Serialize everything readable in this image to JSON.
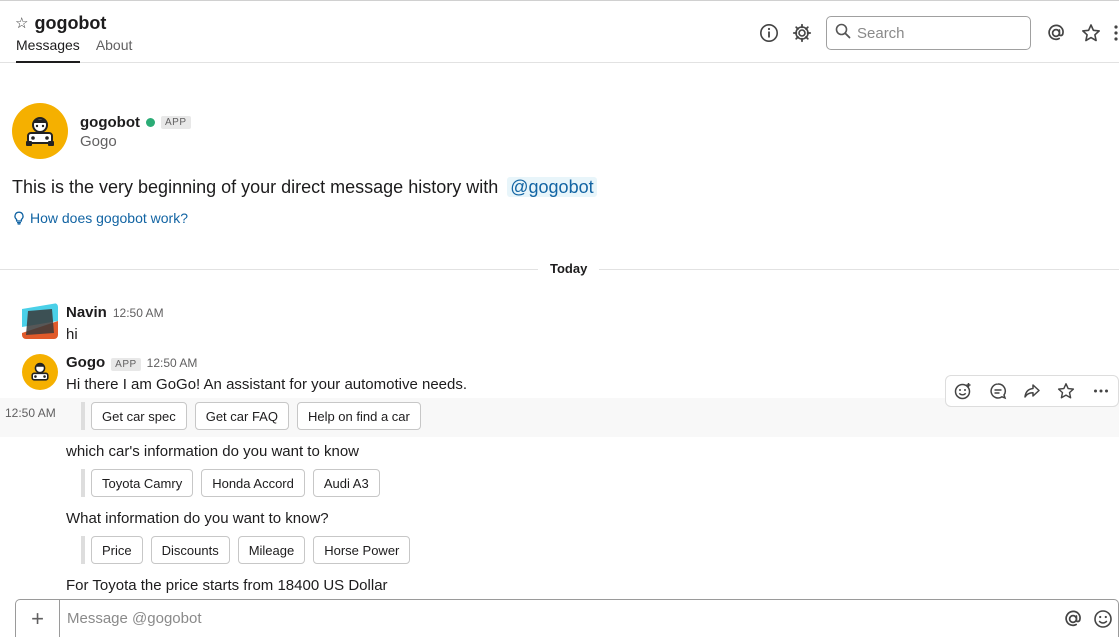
{
  "header": {
    "channel_name": "gogobot",
    "tabs": [
      {
        "label": "Messages",
        "active": true
      },
      {
        "label": "About",
        "active": false
      }
    ],
    "search_placeholder": "Search"
  },
  "intro": {
    "bot_name": "gogobot",
    "app_badge": "APP",
    "subtitle": "Gogo",
    "beginning_text": "This is the very beginning of your direct message history with",
    "mention": "@gogobot",
    "help_link": "How does gogobot work?"
  },
  "divider_label": "Today",
  "messages": [
    {
      "sender": "Navin",
      "time": "12:50 AM",
      "text": "hi"
    },
    {
      "sender": "Gogo",
      "badge": "APP",
      "time": "12:50 AM",
      "text": "Hi there I am GoGo! An assistant for your automotive needs."
    }
  ],
  "hover_timestamp": "12:50 AM",
  "button_groups": [
    {
      "buttons": [
        "Get car spec",
        "Get car FAQ",
        "Help on find a car"
      ]
    },
    {
      "prompt": "which car's information do you want to know",
      "buttons": [
        "Toyota Camry",
        "Honda Accord",
        "Audi A3"
      ]
    },
    {
      "prompt": "What information do you want to know?",
      "buttons": [
        "Price",
        "Discounts",
        "Mileage",
        "Horse Power"
      ]
    }
  ],
  "final_text": "For Toyota the price  starts from  18400 US Dollar",
  "composer": {
    "placeholder": "Message @gogobot"
  },
  "colors": {
    "accent": "#1264a3",
    "bot_avatar": "#f5b000",
    "online": "#2bac76"
  }
}
